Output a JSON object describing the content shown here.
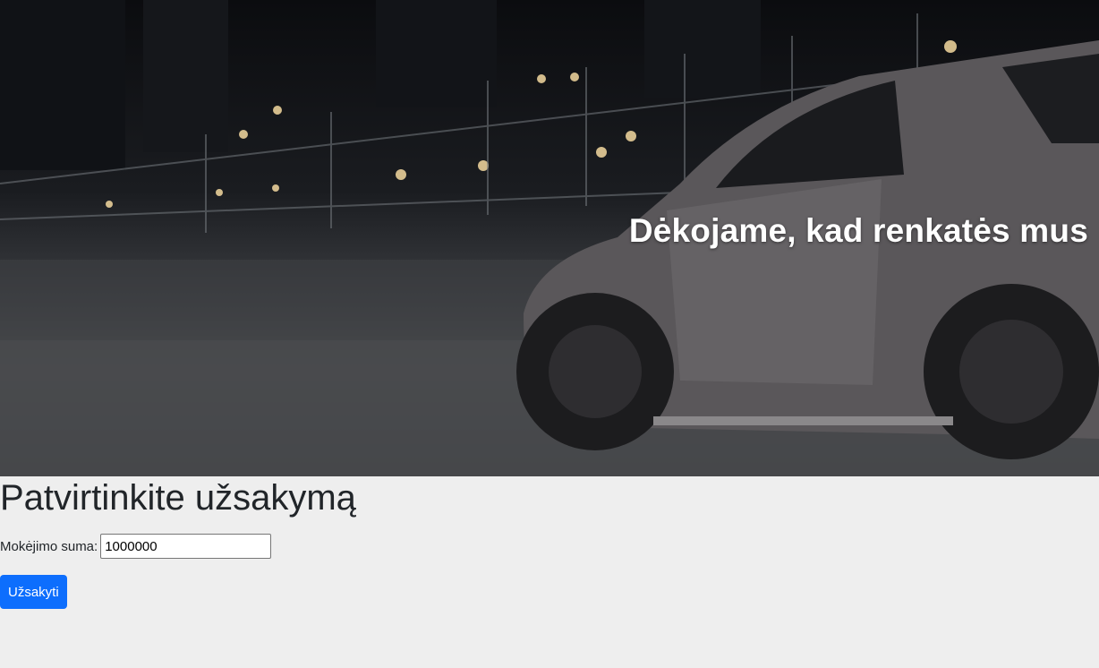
{
  "hero": {
    "title": "Dėkojame, kad renkatės mus",
    "image": "night-street-sports-car-photo"
  },
  "page": {
    "heading": "Patvirtinkite užsakymą"
  },
  "form": {
    "amount_label": "Mokėjimo suma:",
    "amount_value": "1000000",
    "submit_label": "Užsakyti"
  },
  "colors": {
    "page_background": "#eeeeee",
    "primary_button": "#0d6efd",
    "hero_text": "#ffffff"
  }
}
